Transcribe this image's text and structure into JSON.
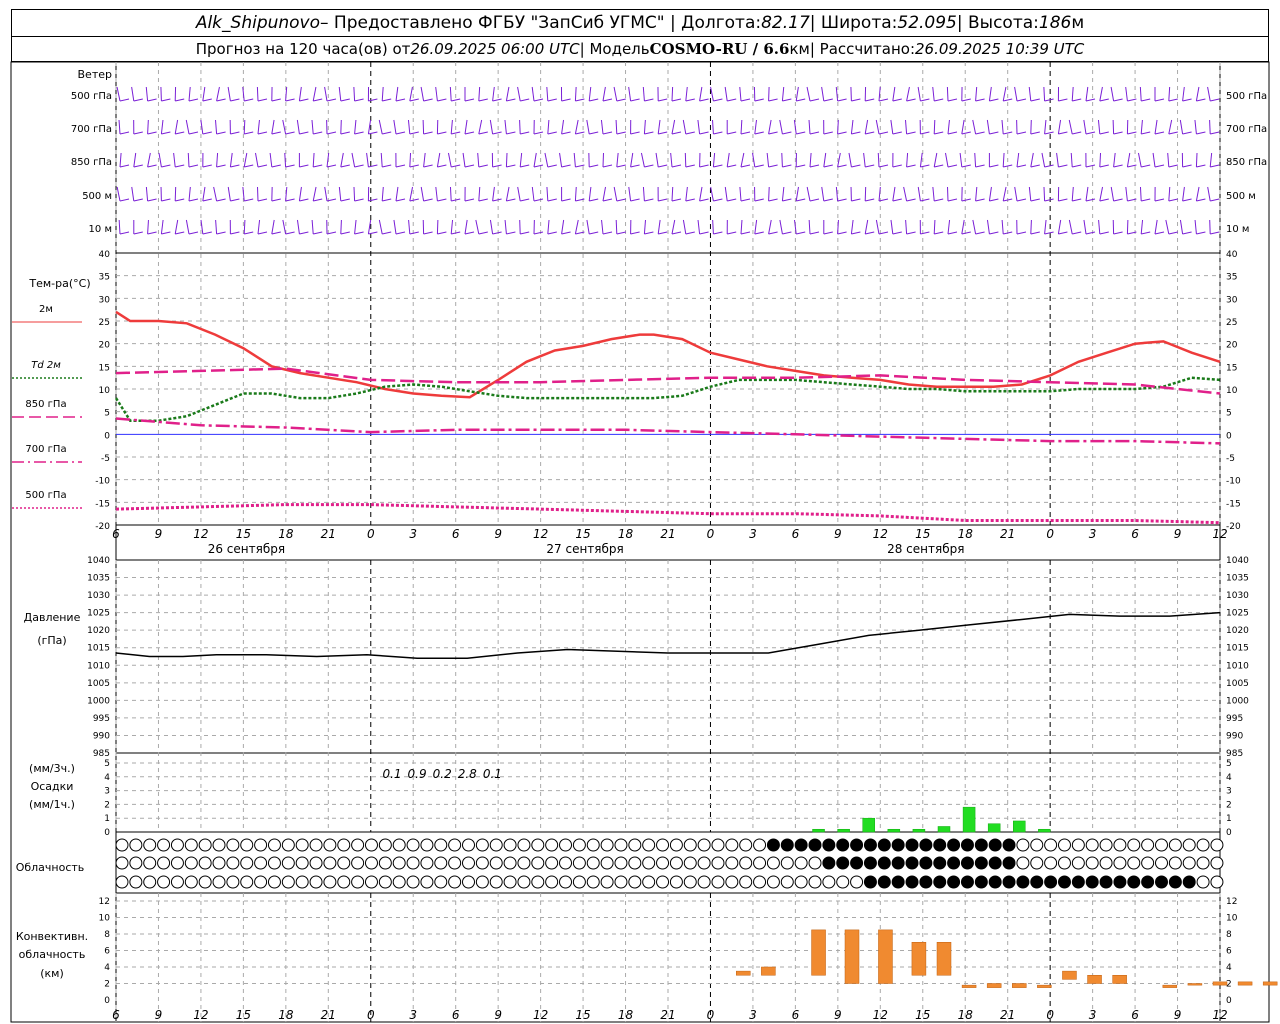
{
  "header": {
    "station": "Alk_Shipunovo",
    "provider": " – Предоставлено ФГБУ \"ЗапСиб УГМС\" | Долгота: ",
    "lon": "82.17",
    "lat_label": " | Широта: ",
    "lat": "52.095",
    "alt_label": " | Высота: ",
    "alt": "186",
    "alt_unit": "м",
    "forecast_label": "Прогноз на 120 часа(ов) от ",
    "forecast_from": "26.09.2025 06:00 UTC",
    "model_label": " | Модель ",
    "model": "COSMO-RU / 6.6",
    "model_unit": "км",
    "calc_label": " | Рассчитано: ",
    "calc": "26.09.2025 10:39 UTC"
  },
  "wind_panel": {
    "title": "Ветер",
    "levels": [
      "500 гПа",
      "700 гПа",
      "850 гПа",
      "500 м",
      "10 м"
    ],
    "color": "#7a1fd6"
  },
  "temp_panel": {
    "title": "Тем-ра(°C)",
    "legend": [
      {
        "label": "2м",
        "color": "#ee3b3b",
        "dash": "solid"
      },
      {
        "label": "Td 2м",
        "color": "#1a7a1a",
        "dash": "dot"
      },
      {
        "label": "850 гПа",
        "color": "#e0208a",
        "dash": "longdash"
      },
      {
        "label": "700 гПа",
        "color": "#e0208a",
        "dash": "dashdot"
      },
      {
        "label": "500 гПа",
        "color": "#e0208a",
        "dash": "dot"
      }
    ],
    "yticks": [
      40,
      35,
      30,
      25,
      20,
      15,
      10,
      5,
      0,
      -5,
      -10,
      -15,
      -20
    ]
  },
  "time_axis": {
    "hour_labels": [
      "6",
      "9",
      "12",
      "15",
      "18",
      "21",
      "0",
      "3",
      "6",
      "9",
      "12",
      "15",
      "18",
      "21",
      "0",
      "3",
      "6",
      "9",
      "12",
      "15",
      "18",
      "21",
      "0",
      "3",
      "6",
      "9",
      "12"
    ],
    "day_labels": [
      "26 сентября",
      "27 сентября",
      "28 сентября"
    ]
  },
  "pressure_panel": {
    "title": "Давление",
    "unit": "(гПа)",
    "yticks": [
      1040,
      1035,
      1030,
      1025,
      1020,
      1015,
      1010,
      1005,
      1000,
      995,
      990,
      985
    ]
  },
  "precip_panel": {
    "unit3h": "(мм/3ч.)",
    "title": "Осадки",
    "unit1h": "(мм/1ч.)",
    "yticks": [
      5,
      4,
      3,
      2,
      1,
      0
    ],
    "totals": [
      {
        "hour": 33,
        "label": "0.1"
      },
      {
        "hour": 36,
        "label": "0.9"
      },
      {
        "hour": 39,
        "label": "0.2"
      },
      {
        "hour": 42,
        "label": "2.8"
      },
      {
        "hour": 45,
        "label": "0.1"
      }
    ],
    "color": "#22dd22"
  },
  "cloud_panel": {
    "title": "Облачность"
  },
  "conv_panel": {
    "title1": "Конвективн.",
    "title2": "облачность",
    "unit": "(км)",
    "yticks": [
      12,
      10,
      8,
      6,
      4,
      2,
      0
    ],
    "color": "#f08a30"
  },
  "chart_data": {
    "type": "line",
    "x_hours_from_start": "0..78",
    "temperature_2m": [
      [
        0,
        27
      ],
      [
        1,
        25
      ],
      [
        3,
        25
      ],
      [
        5,
        24.5
      ],
      [
        7,
        22
      ],
      [
        9,
        19
      ],
      [
        11,
        15
      ],
      [
        13,
        13.5
      ],
      [
        15,
        12.5
      ],
      [
        17,
        11.5
      ],
      [
        19,
        10
      ],
      [
        21,
        9
      ],
      [
        23,
        8.5
      ],
      [
        25,
        8.2
      ],
      [
        27,
        12
      ],
      [
        29,
        16
      ],
      [
        31,
        18.5
      ],
      [
        33,
        19.5
      ],
      [
        35,
        21
      ],
      [
        37,
        22
      ],
      [
        38,
        22
      ],
      [
        40,
        21
      ],
      [
        42,
        18
      ],
      [
        44,
        16.5
      ],
      [
        46,
        15
      ],
      [
        48,
        14
      ],
      [
        50,
        13
      ],
      [
        52,
        12.5
      ],
      [
        54,
        12
      ],
      [
        56,
        11
      ],
      [
        58,
        10.5
      ],
      [
        60,
        10.5
      ],
      [
        62,
        10.5
      ],
      [
        64,
        11
      ],
      [
        66,
        13
      ],
      [
        68,
        16
      ],
      [
        70,
        18
      ],
      [
        72,
        20
      ],
      [
        74,
        20.5
      ],
      [
        76,
        18
      ],
      [
        78,
        16
      ]
    ],
    "dewpoint_2m": [
      [
        0,
        8
      ],
      [
        1,
        3
      ],
      [
        3,
        3
      ],
      [
        5,
        4
      ],
      [
        7,
        6.5
      ],
      [
        9,
        9
      ],
      [
        11,
        9
      ],
      [
        13,
        8
      ],
      [
        15,
        8
      ],
      [
        17,
        9
      ],
      [
        19,
        10.5
      ],
      [
        21,
        11
      ],
      [
        23,
        10.5
      ],
      [
        25,
        9.5
      ],
      [
        27,
        8.5
      ],
      [
        29,
        8
      ],
      [
        31,
        8
      ],
      [
        33,
        8
      ],
      [
        35,
        8
      ],
      [
        37,
        8
      ],
      [
        38,
        8
      ],
      [
        40,
        8.5
      ],
      [
        42,
        10.5
      ],
      [
        44,
        12
      ],
      [
        46,
        12
      ],
      [
        48,
        12
      ],
      [
        50,
        11.5
      ],
      [
        52,
        11
      ],
      [
        54,
        10.5
      ],
      [
        56,
        10
      ],
      [
        58,
        10
      ],
      [
        60,
        9.5
      ],
      [
        62,
        9.5
      ],
      [
        64,
        9.5
      ],
      [
        66,
        9.5
      ],
      [
        68,
        10
      ],
      [
        70,
        10
      ],
      [
        72,
        10
      ],
      [
        74,
        10.5
      ],
      [
        76,
        12.5
      ],
      [
        78,
        12
      ]
    ],
    "t850": [
      [
        0,
        13.5
      ],
      [
        6,
        14
      ],
      [
        12,
        14.5
      ],
      [
        18,
        12
      ],
      [
        24,
        11.5
      ],
      [
        30,
        11.5
      ],
      [
        36,
        12
      ],
      [
        42,
        12.5
      ],
      [
        48,
        12.5
      ],
      [
        54,
        13
      ],
      [
        60,
        12
      ],
      [
        66,
        11.5
      ],
      [
        72,
        11
      ],
      [
        78,
        9
      ]
    ],
    "t700": [
      [
        0,
        3.5
      ],
      [
        6,
        2
      ],
      [
        12,
        1.5
      ],
      [
        18,
        0.5
      ],
      [
        24,
        1
      ],
      [
        30,
        1
      ],
      [
        36,
        1
      ],
      [
        42,
        0.5
      ],
      [
        48,
        0
      ],
      [
        54,
        -0.5
      ],
      [
        60,
        -1
      ],
      [
        66,
        -1.5
      ],
      [
        72,
        -1.5
      ],
      [
        78,
        -2
      ]
    ],
    "t500": [
      [
        0,
        -16.5
      ],
      [
        6,
        -16
      ],
      [
        12,
        -15.5
      ],
      [
        18,
        -15.5
      ],
      [
        24,
        -16
      ],
      [
        30,
        -16.5
      ],
      [
        36,
        -17
      ],
      [
        42,
        -17.5
      ],
      [
        48,
        -17.5
      ],
      [
        54,
        -18
      ],
      [
        60,
        -19
      ],
      [
        66,
        -19
      ],
      [
        72,
        -19
      ],
      [
        78,
        -19.5
      ]
    ],
    "pressure": [
      [
        0,
        1013.5
      ],
      [
        4,
        1012.5
      ],
      [
        8,
        1012.5
      ],
      [
        12,
        1013
      ],
      [
        18,
        1013
      ],
      [
        24,
        1012.5
      ],
      [
        30,
        1013
      ],
      [
        36,
        1012
      ],
      [
        42,
        1012
      ],
      [
        48,
        1013.5
      ],
      [
        54,
        1014.5
      ],
      [
        60,
        1014
      ],
      [
        66,
        1013.5
      ],
      [
        72,
        1013.5
      ],
      [
        78,
        1013.5
      ],
      [
        84,
        1016
      ],
      [
        90,
        1018.5
      ],
      [
        96,
        1020
      ],
      [
        102,
        1021.5
      ],
      [
        108,
        1023
      ],
      [
        114,
        1024.5
      ],
      [
        120,
        1024
      ],
      [
        126,
        1024
      ],
      [
        132,
        1025
      ]
    ],
    "precip_1h": [
      [
        84,
        0.2
      ],
      [
        87,
        0.2
      ],
      [
        90,
        1
      ],
      [
        93,
        0.2
      ],
      [
        96,
        0.2
      ],
      [
        99,
        0.4
      ],
      [
        102,
        1.8
      ],
      [
        105,
        0.6
      ],
      [
        108,
        0.8
      ],
      [
        111,
        0.2
      ]
    ],
    "conv_cloud_km": [
      [
        75,
        3,
        3.5
      ],
      [
        78,
        3,
        4
      ],
      [
        84,
        3,
        8.5
      ],
      [
        88,
        2,
        8.5
      ],
      [
        92,
        2,
        8.5
      ],
      [
        96,
        3,
        7
      ],
      [
        99,
        3,
        7
      ],
      [
        102,
        1.5,
        1.8
      ],
      [
        105,
        1.5,
        2
      ],
      [
        108,
        1.5,
        2
      ],
      [
        111,
        1.5,
        1.8
      ],
      [
        114,
        2.5,
        3.5
      ],
      [
        117,
        2,
        3
      ],
      [
        120,
        2,
        3
      ],
      [
        126,
        1.5,
        1.8
      ],
      [
        129,
        1.8,
        2
      ],
      [
        132,
        1.8,
        2.2
      ],
      [
        135,
        1.8,
        2.2
      ],
      [
        138,
        1.8,
        2.2
      ],
      [
        141,
        1.8,
        2
      ]
    ],
    "xlim_hours": [
      0,
      78
    ],
    "ylim_temp": [
      -20,
      40
    ],
    "ylim_pressure": [
      985,
      1040
    ]
  }
}
